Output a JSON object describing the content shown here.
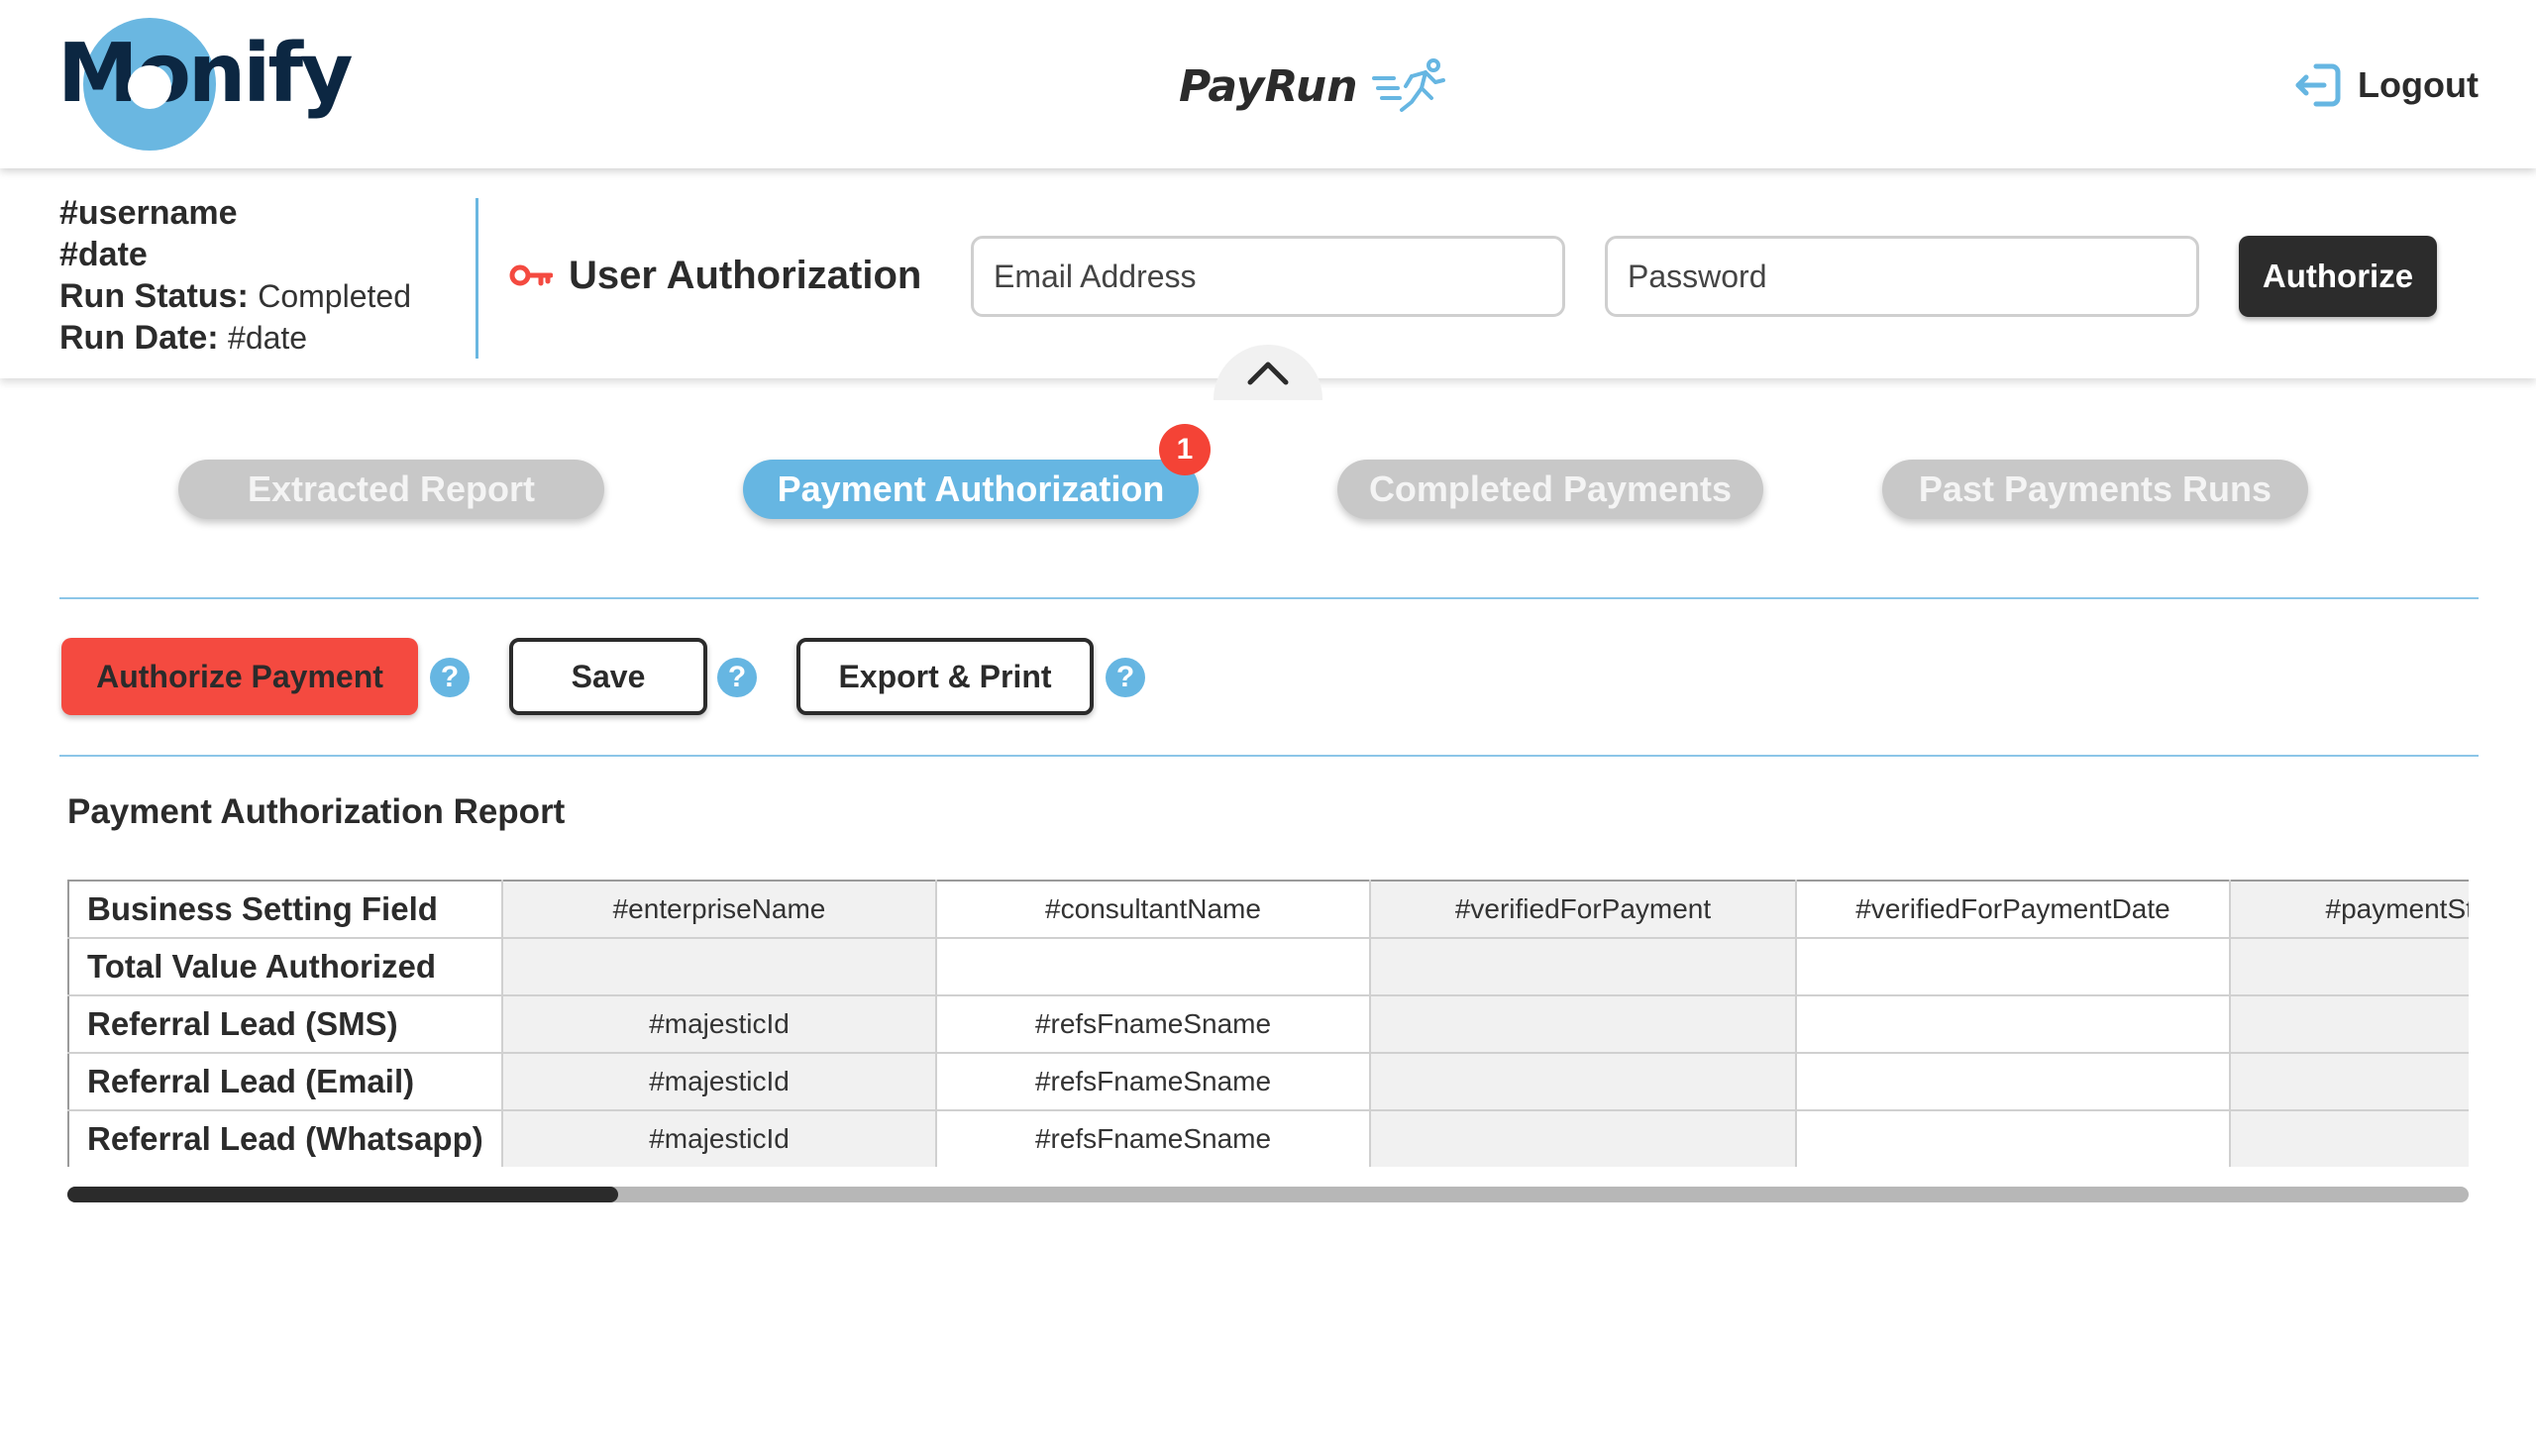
{
  "header": {
    "logo_text": "Monify",
    "brand_name": "PayRun",
    "brand_icon": "running-person-icon",
    "logout_label": "Logout",
    "logout_icon": "logout-arrow-icon",
    "colors": {
      "logo_circle": "#6ab7e1",
      "logo_text": "#0c2742",
      "accent": "#66b6e2"
    }
  },
  "run_info": {
    "username": "#username",
    "date": "#date",
    "status_label": "Run Status:",
    "status_value": "Completed",
    "run_date_label": "Run Date:",
    "run_date_value": "#date"
  },
  "auth": {
    "label": "User Authorization",
    "key_icon": "key-icon",
    "email_placeholder": "Email Address",
    "password_placeholder": "Password",
    "authorize_label": "Authorize"
  },
  "tabs": [
    {
      "label": "Extracted Report",
      "active": false
    },
    {
      "label": "Payment Authorization",
      "active": true,
      "badge": "1"
    },
    {
      "label": "Completed Payments",
      "active": false
    },
    {
      "label": "Past Payments Runs",
      "active": false
    }
  ],
  "actions": {
    "authorize_payment_label": "Authorize Payment",
    "save_label": "Save",
    "export_print_label": "Export & Print",
    "help_symbol": "?",
    "colors": {
      "authorize_payment_bg": "#f44a40"
    }
  },
  "report": {
    "title": "Payment Authorization Report",
    "rows": [
      {
        "label": "Business Setting Field",
        "cells": [
          "#enterpriseName",
          "#consultantName",
          "#verifiedForPayment",
          "#verifiedForPaymentDate",
          "#paymentSta"
        ]
      },
      {
        "label": "Total Value Authorized",
        "cells": [
          "",
          "",
          "",
          "",
          ""
        ]
      },
      {
        "label": "Referral Lead (SMS)",
        "cells": [
          "#majesticId",
          "#refsFnameSname",
          "",
          "",
          ""
        ]
      },
      {
        "label": "Referral Lead (Email)",
        "cells": [
          "#majesticId",
          "#refsFnameSname",
          "",
          "",
          ""
        ]
      },
      {
        "label": "Referral Lead (Whatsapp)",
        "cells": [
          "#majesticId",
          "#refsFnameSname",
          "",
          "",
          ""
        ]
      }
    ],
    "horizontal_scroll_position": 0.0
  }
}
